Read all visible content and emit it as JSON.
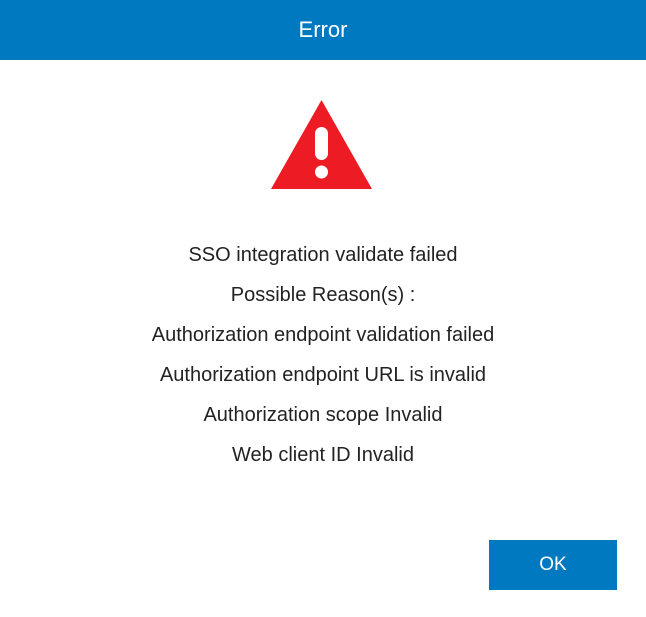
{
  "dialog": {
    "title": "Error",
    "icon": "warning-triangle-icon",
    "messages": [
      "SSO integration validate failed",
      "Possible Reason(s) :",
      "Authorization endpoint validation failed",
      "Authorization endpoint URL is invalid",
      "Authorization scope Invalid",
      "Web client ID Invalid"
    ],
    "ok_label": "OK"
  },
  "colors": {
    "title_bar": "#0079C1",
    "button": "#0079C1",
    "warning": "#ED1C24"
  }
}
